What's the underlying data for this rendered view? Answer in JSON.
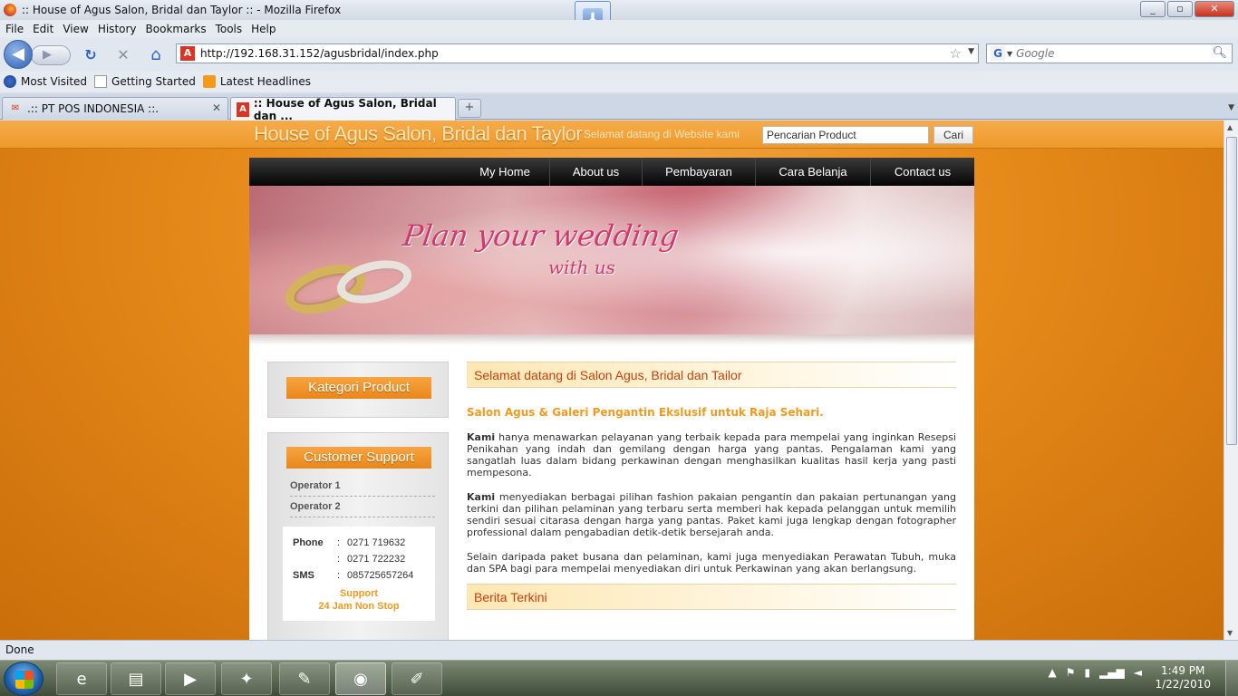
{
  "window": {
    "title": ":: House of Agus Salon, Bridal dan Taylor :: - Mozilla Firefox",
    "controls": {
      "minimize": "_",
      "maximize": "▫",
      "close": "✕"
    }
  },
  "menubar": [
    "File",
    "Edit",
    "View",
    "History",
    "Bookmarks",
    "Tools",
    "Help"
  ],
  "navigation": {
    "back": "◀",
    "forward": "▶",
    "reload": "↻",
    "stop": "✕",
    "home": "⌂",
    "url": "http://192.168.31.152/agusbridal/index.php",
    "search_placeholder": "Google",
    "search_engine_icon": "G"
  },
  "bookmarks": [
    "Most Visited",
    "Getting Started",
    "Latest Headlines"
  ],
  "tabs": [
    {
      "label": ".:: PT POS INDONESIA ::.",
      "active": false
    },
    {
      "label": ":: House of Agus Salon, Bridal dan ...",
      "active": true
    }
  ],
  "site": {
    "logo": "House of Agus Salon, Bridal dan Taylor",
    "welcome_top": "Selamat datang di Website kami",
    "search_value": "Pencarian Product",
    "search_button": "Cari",
    "nav": [
      "My Home",
      "About us",
      "Pembayaran",
      "Cara Belanja",
      "Contact us"
    ],
    "banner": {
      "line1": "Plan your wedding",
      "line2": "with us"
    },
    "sidebar": {
      "kategori_title": "Kategori Product",
      "support_title": "Customer Support",
      "operators": [
        "Operator 1",
        "Operator 2"
      ],
      "phone_label": "Phone",
      "phone_values": [
        "0271 719632",
        "0271 722232"
      ],
      "sms_label": "SMS",
      "sms_value": "085725657264",
      "support_line1": "Support",
      "support_line2": "24 Jam Non Stop",
      "colon": ":"
    },
    "main": {
      "welcome_heading": "Selamat datang di Salon Agus, Bridal dan Tailor",
      "subtitle": "Salon Agus & Galeri Pengantin Ekslusif untuk Raja Sehari.",
      "para1_lead": "Kami",
      "para1_text": " hanya menawarkan pelayanan yang terbaik kepada para mempelai yang inginkan Resepsi Penikahan yang indah dan gemilang dengan harga yang pantas. Pengalaman kami yang sangatlah luas dalam bidang perkawinan dengan menghasilkan kualitas hasil kerja yang pasti mempesona.",
      "para2_lead": "Kami",
      "para2_text": " menyediakan berbagai pilihan fashion pakaian pengantin dan pakaian pertunangan yang terkini dan pilihan pelaminan yang terbaru serta memberi hak kepada pelanggan untuk memilih sendiri sesuai citarasa dengan harga yang pantas. Paket kami juga lengkap dengan fotographer professional dalam pengabadian detik-detik bersejarah anda.",
      "para3_text": "Selain daripada paket busana dan pelaminan, kami juga menyediakan Perawatan Tubuh, muka dan SPA bagi para mempelai menyediakan diri untuk Perkawinan yang akan berlangsung.",
      "news_heading": "Berita Terkini"
    }
  },
  "status": "Done",
  "taskbar": {
    "clock_time": "1:49 PM",
    "clock_date": "1/22/2010"
  }
}
